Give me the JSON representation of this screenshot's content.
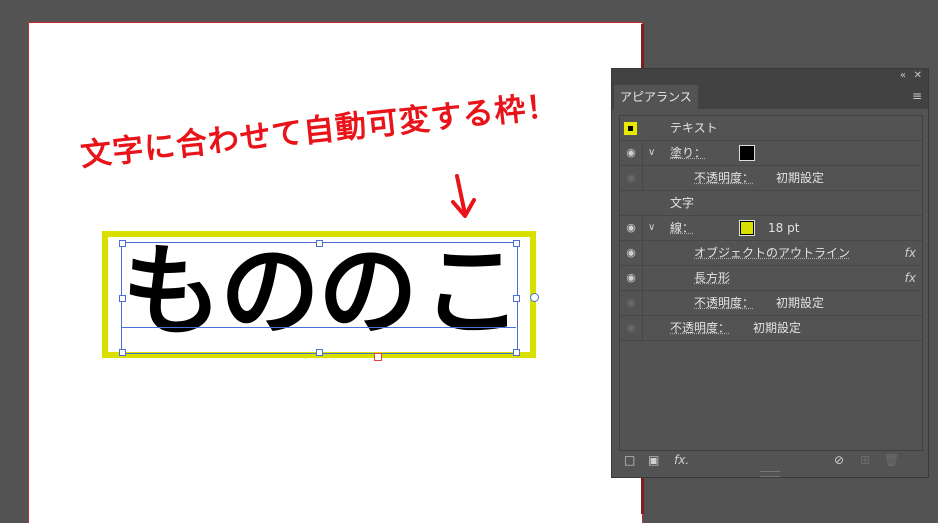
{
  "canvas": {
    "annotation": "文字に合わせて自動可変する枠！",
    "main_text": "ものの こ"
  },
  "panel": {
    "title_tab": "アピアランス",
    "rows": [
      {
        "label": "テキスト"
      },
      {
        "label": "塗り：",
        "swatch_color": "#000000"
      },
      {
        "label": "不透明度：",
        "value": "初期設定"
      },
      {
        "label": "文字"
      },
      {
        "label": "線：",
        "swatch_color": "#d9e000",
        "value": "18 pt"
      },
      {
        "label": "オブジェクトのアウトライン",
        "fx": "fx"
      },
      {
        "label": "長方形",
        "fx": "fx"
      },
      {
        "label": "不透明度：",
        "value": "初期設定"
      },
      {
        "label": "不透明度：",
        "value": "初期設定"
      }
    ],
    "icons": {
      "collapse": "«",
      "close": "✕",
      "menu": "≡",
      "eye": "👁",
      "chevron": "⌄"
    }
  }
}
